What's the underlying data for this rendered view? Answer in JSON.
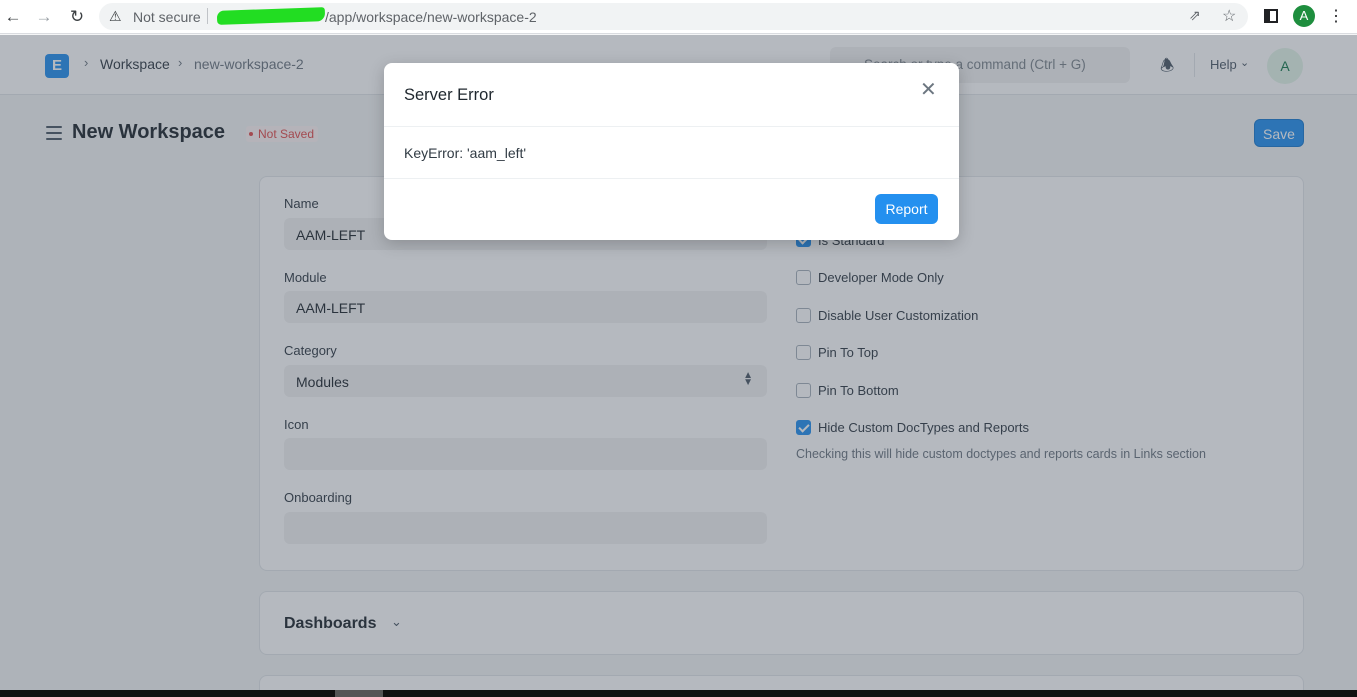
{
  "browser": {
    "security_label": "Not secure",
    "url_path": "/app/workspace/new-workspace-2"
  },
  "navbar": {
    "logo_letter": "E",
    "breadcrumbs": [
      "Workspace",
      "new-workspace-2"
    ],
    "search_placeholder": "Search or type a command (Ctrl + G)",
    "help_label": "Help",
    "avatar_initial": "A"
  },
  "page": {
    "title": "New Workspace",
    "status": "Not Saved",
    "save_label": "Save"
  },
  "form": {
    "fields": [
      {
        "label": "Name",
        "value": "AAM-LEFT"
      },
      {
        "label": "Module",
        "value": "AAM-LEFT"
      },
      {
        "label": "Category",
        "value": "Modules"
      },
      {
        "label": "Icon",
        "value": ""
      },
      {
        "label": "Onboarding",
        "value": ""
      }
    ],
    "checkboxes": [
      {
        "label": "Is Standard",
        "checked": true
      },
      {
        "label": "Developer Mode Only",
        "checked": false
      },
      {
        "label": "Disable User Customization",
        "checked": false
      },
      {
        "label": "Pin To Top",
        "checked": false
      },
      {
        "label": "Pin To Bottom",
        "checked": false
      },
      {
        "label": "Hide Custom DocTypes and Reports",
        "checked": true
      }
    ],
    "help_text": "Checking this will hide custom doctypes and reports cards in Links section"
  },
  "sections": {
    "dashboards": "Dashboards"
  },
  "modal": {
    "title": "Server Error",
    "message": "KeyError: 'aam_left'",
    "report_label": "Report"
  },
  "colors": {
    "primary": "#2490ef",
    "danger": "#e24c4c"
  }
}
